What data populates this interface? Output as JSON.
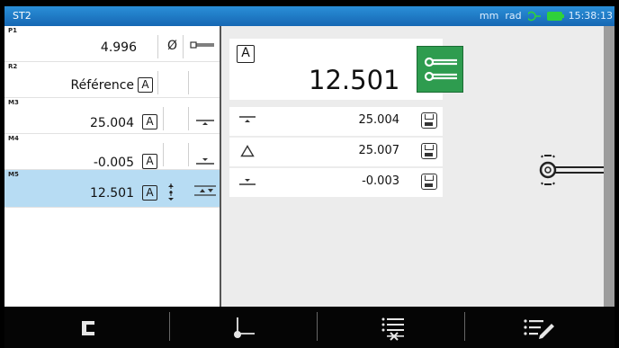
{
  "titlebar": {
    "title": "ST2",
    "units": "mm",
    "angle_unit": "rad",
    "time": "15:38:13",
    "color": "#1a73c2"
  },
  "rows": [
    {
      "tag": "P1",
      "value": "4.996",
      "symbol": "Ø"
    },
    {
      "tag": "R2",
      "value": "Référence",
      "abox": "A"
    },
    {
      "tag": "M3",
      "value": "25.004",
      "abox": "A"
    },
    {
      "tag": "M4",
      "value": "-0.005",
      "abox": "A"
    },
    {
      "tag": "M5",
      "value": "12.501",
      "abox": "A"
    }
  ],
  "selected_row": 4,
  "main": {
    "abox": "A",
    "value": "12.501",
    "measures": [
      {
        "value": "25.004"
      },
      {
        "value": "25.007"
      },
      {
        "value": "-0.003"
      }
    ],
    "accent": "#2e9c4f"
  }
}
